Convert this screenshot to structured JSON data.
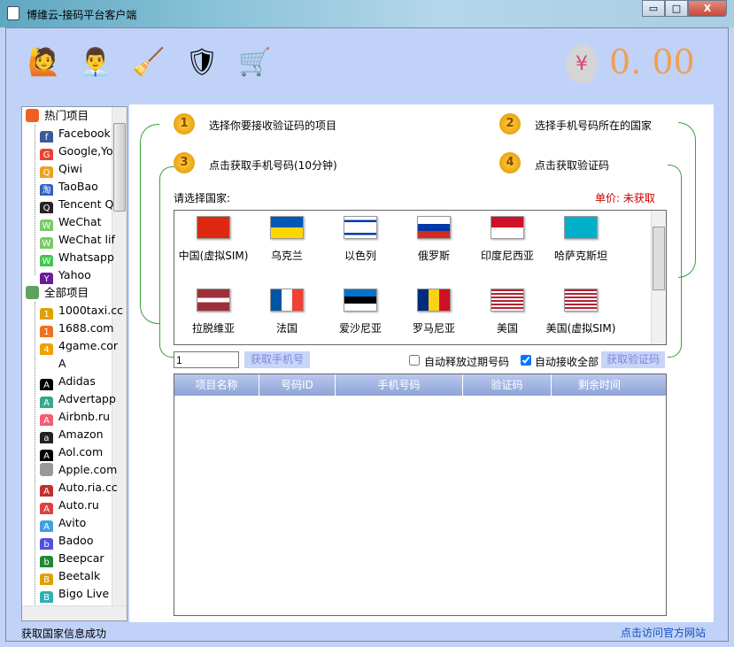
{
  "window": {
    "title": "博维云-接码平台客户端",
    "min": "▭",
    "max": "□",
    "close": "X"
  },
  "toolbar": {
    "icons": [
      "help-user-icon",
      "support-agent-icon",
      "broom-clean-icon",
      "shield-icon",
      "cart-icon"
    ],
    "balance": "0. 00",
    "currency": "¥"
  },
  "tree": {
    "items": [
      {
        "label": "热门项目",
        "group": true,
        "color": "#f06020"
      },
      {
        "label": "Facebook",
        "color": "#3b5998",
        "g": "f"
      },
      {
        "label": "Google,Yo",
        "color": "#ea4335",
        "g": "G"
      },
      {
        "label": "Qiwi",
        "color": "#f0a020",
        "g": "Q"
      },
      {
        "label": "TaoBao",
        "color": "#3060c0",
        "g": "淘"
      },
      {
        "label": "Tencent Q",
        "color": "#222",
        "g": "Q"
      },
      {
        "label": "WeChat",
        "color": "#7bc86c",
        "g": "W"
      },
      {
        "label": "WeChat lif",
        "color": "#7bc86c",
        "g": "W"
      },
      {
        "label": "Whatsapp",
        "color": "#3ec850",
        "g": "W"
      },
      {
        "label": "Yahoo",
        "color": "#6a1b9a",
        "g": "Y"
      },
      {
        "label": "全部项目",
        "group": true,
        "color": "#60a060"
      },
      {
        "label": "1000taxi.cc",
        "color": "#e0a000",
        "g": "1"
      },
      {
        "label": "1688.com",
        "color": "#f07020",
        "g": "1"
      },
      {
        "label": "4game.cor",
        "color": "#f0a000",
        "g": "4"
      },
      {
        "label": "A",
        "color": "#ffffff",
        "g": ""
      },
      {
        "label": "Adidas",
        "color": "#000",
        "g": "A"
      },
      {
        "label": "Advertapp",
        "color": "#3a8",
        "g": "A"
      },
      {
        "label": "Airbnb.ru",
        "color": "#f06070",
        "g": "A"
      },
      {
        "label": "Amazon",
        "color": "#222",
        "g": "a"
      },
      {
        "label": "Aol.com",
        "color": "#000",
        "g": "A"
      },
      {
        "label": "Apple.com",
        "color": "#999",
        "g": ""
      },
      {
        "label": "Auto.ria.cc",
        "color": "#c03030",
        "g": "A"
      },
      {
        "label": "Auto.ru",
        "color": "#e04040",
        "g": "A"
      },
      {
        "label": "Avito",
        "color": "#40a0e0",
        "g": "A"
      },
      {
        "label": "Badoo",
        "color": "#5050e0",
        "g": "b"
      },
      {
        "label": "Beepcar",
        "color": "#228833",
        "g": "b"
      },
      {
        "label": "Beetalk",
        "color": "#e0a000",
        "g": "B"
      },
      {
        "label": "Bigo Live",
        "color": "#30b0b0",
        "g": "B"
      }
    ]
  },
  "steps": [
    {
      "n": "1",
      "text": "选择你要接收验证码的项目"
    },
    {
      "n": "2",
      "text": "选择手机号码所在的国家"
    },
    {
      "n": "3",
      "text": "点击获取手机号码(10分钟)"
    },
    {
      "n": "4",
      "text": "点击获取验证码"
    }
  ],
  "country": {
    "label": "请选择国家:",
    "price": "单价: 未获取",
    "items": [
      {
        "name": "中国(虚拟SIM)",
        "flag": "linear-gradient(#de2910,#de2910)"
      },
      {
        "name": "乌克兰",
        "flag": "linear-gradient(#0057b7 50%,#ffd700 50%)"
      },
      {
        "name": "以色列",
        "flag": "linear-gradient(#fff 15%,#0038b8 15%,#0038b8 25%,#fff 25%,#fff 75%,#0038b8 75%,#0038b8 85%,#fff 85%)"
      },
      {
        "name": "俄罗斯",
        "flag": "linear-gradient(#fff 33%,#0039a6 33%,#0039a6 66%,#d52b1e 66%)"
      },
      {
        "name": "印度尼西亚",
        "flag": "linear-gradient(#ce1126 50%,#fff 50%)"
      },
      {
        "name": "哈萨克斯坦",
        "flag": "linear-gradient(#00afca,#00afca)"
      },
      {
        "name": "拉脱维亚",
        "flag": "linear-gradient(#9e3039 40%,#fff 40%,#fff 60%,#9e3039 60%)"
      },
      {
        "name": "法国",
        "flag": "linear-gradient(90deg,#0055a4 33%,#fff 33%,#fff 66%,#ef4135 66%)"
      },
      {
        "name": "爱沙尼亚",
        "flag": "linear-gradient(#0072ce 33%,#000 33%,#000 66%,#fff 66%)"
      },
      {
        "name": "罗马尼亚",
        "flag": "linear-gradient(90deg,#002b7f 33%,#fcd116 33%,#fcd116 66%,#ce1126 66%)"
      },
      {
        "name": "美国",
        "flag": "repeating-linear-gradient(#b22234 0 2px,#fff 2px 4px)"
      },
      {
        "name": "美国(虚拟SIM)",
        "flag": "repeating-linear-gradient(#b22234 0 2px,#fff 2px 4px)"
      }
    ]
  },
  "controls": {
    "quantity": "1",
    "get_phone": "获取手机号",
    "auto_release": "自动释放过期号码",
    "auto_release_checked": false,
    "auto_receive": "自动接收全部",
    "auto_receive_checked": true,
    "get_code": "获取验证码"
  },
  "table": {
    "columns": [
      "项目名称",
      "号码ID",
      "手机号码",
      "验证码",
      "剩余时间"
    ],
    "rows": []
  },
  "status": {
    "text": "获取国家信息成功",
    "link": "点击访问官方网站"
  },
  "colors": {
    "accent": "#c0d2f8",
    "price": "#cc0000",
    "balance": "#f0a050"
  }
}
